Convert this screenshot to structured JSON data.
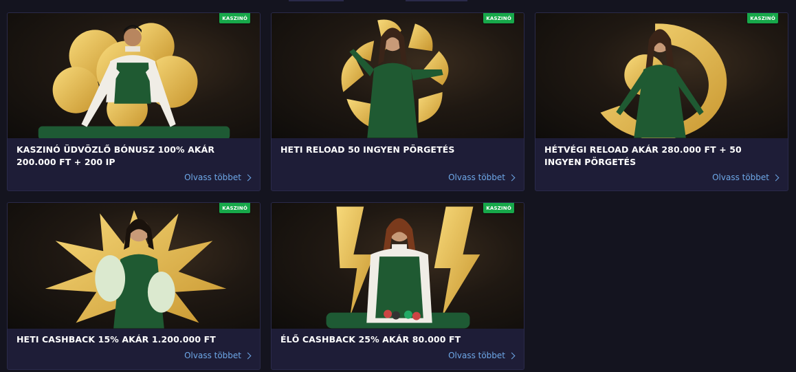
{
  "promotions": [
    {
      "badge": "KASZINÓ",
      "title": "KASZINÓ ÜDVÖZLŐ BÓNUSZ 100% AKÁR 200.000 FT + 200 IP",
      "link_label": "Olvass többet",
      "image_icon": "clover-icon"
    },
    {
      "badge": "KASZINÓ",
      "title": "HETI RELOAD 50 INGYEN PÖRGETÉS",
      "link_label": "Olvass többet",
      "image_icon": "spiral-icon"
    },
    {
      "badge": "KASZINÓ",
      "title": "HÉTVÉGI RELOAD AKÁR 280.000 FT + 50 INGYEN PÖRGETÉS",
      "link_label": "Olvass többet",
      "image_icon": "number-nine-icon"
    },
    {
      "badge": "KASZINÓ",
      "title": "HETI CASHBACK 15% AKÁR 1.200.000 FT",
      "link_label": "Olvass többet",
      "image_icon": "starburst-icon"
    },
    {
      "badge": "KASZINÓ",
      "title": "ÉLŐ CASHBACK 25% AKÁR 80.000 FT",
      "link_label": "Olvass többet",
      "image_icon": "lightning-icon"
    }
  ],
  "colors": {
    "page_background": "#14141f",
    "card_background": "#1e1d37",
    "badge_green": "#17a84a",
    "link_blue": "#6ea8e8",
    "gold": "#e8c25a",
    "dress_green": "#1f5a32"
  }
}
